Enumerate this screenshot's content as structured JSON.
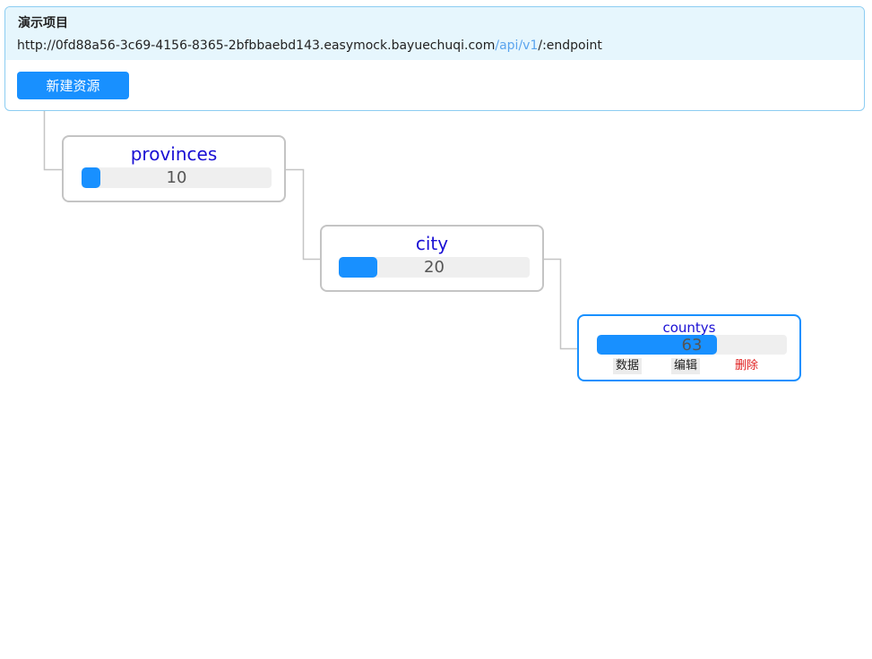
{
  "project": {
    "title": "演示项目",
    "url_base": "http://0fd88a56-3c69-4156-8365-2bfbbaebd143.easymock.bayuechuqi.com",
    "url_path": "/api/v1",
    "url_suffix": "/:endpoint",
    "new_button": "新建资源"
  },
  "nodes": [
    {
      "name": "provinces",
      "value": "10",
      "fill_fraction": 0.1
    },
    {
      "name": "city",
      "value": "20",
      "fill_fraction": 0.2
    },
    {
      "name": "countys",
      "value": "63",
      "fill_fraction": 0.63,
      "actions": {
        "data": "数据",
        "edit": "编辑",
        "delete": "删除"
      }
    }
  ],
  "colors": {
    "accent": "#1890ff",
    "node_name": "#1a10d4",
    "danger": "#e02020",
    "project_header_bg": "#e6f6fd"
  }
}
